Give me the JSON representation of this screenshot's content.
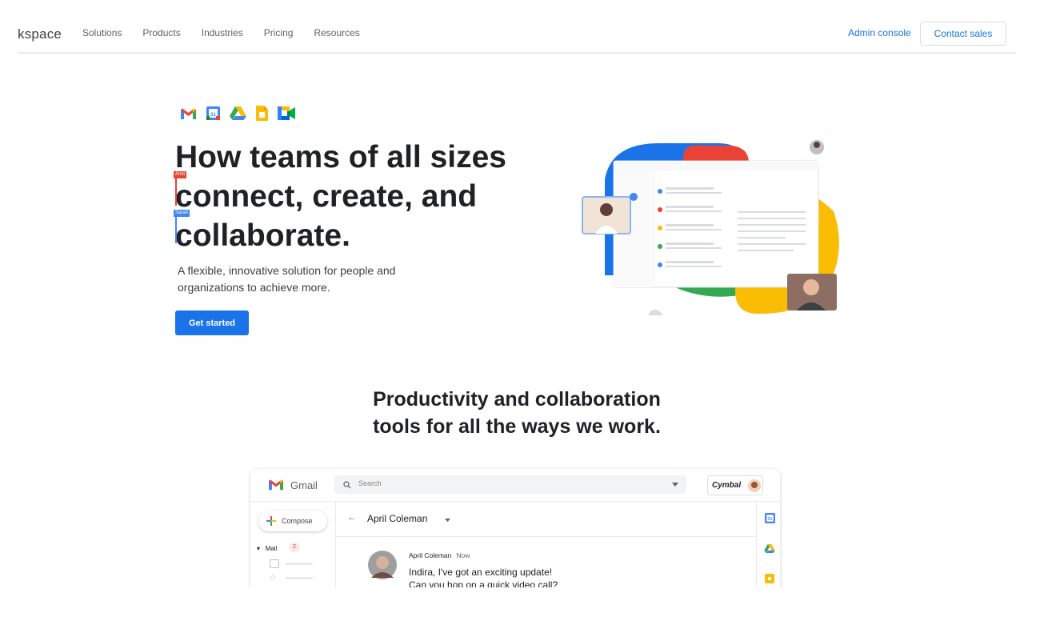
{
  "nav": {
    "brand": "kspace",
    "links": [
      "Solutions",
      "Products",
      "Industries",
      "Pricing",
      "Resources"
    ],
    "admin_console": "Admin console",
    "contact_sales": "Contact sales"
  },
  "hero": {
    "apps": [
      "gmail-icon",
      "calendar-icon",
      "drive-icon",
      "docs-icon",
      "meet-icon"
    ],
    "calendar_day": "31",
    "headline": [
      "How teams of all sizes",
      "connect, create, and",
      "collaborate."
    ],
    "cursor_amit": "Amit",
    "cursor_sarah": "Sarah",
    "subtitle": "A flexible, innovative solution for people and organizations to achieve more.",
    "cta": "Get started",
    "colors": {
      "blue": "#1a73e8",
      "red": "#ea4335",
      "green": "#34a853",
      "yellow": "#fbbc04"
    }
  },
  "section2": {
    "title_line1": "Productivity and collaboration",
    "title_line2": "tools for all the ways we work."
  },
  "gmail": {
    "title": "Gmail",
    "search_placeholder": "Search",
    "org": "Cymbal",
    "compose": "Compose",
    "mail_label": "Mail",
    "mail_count": "2",
    "conversation_name": "April Coleman",
    "sender": "April Coleman",
    "time": "Now",
    "message_line1": "Indira, I've got an exciting update!",
    "message_line2": "Can you hop on a quick video call?",
    "calendar_day": "31"
  }
}
